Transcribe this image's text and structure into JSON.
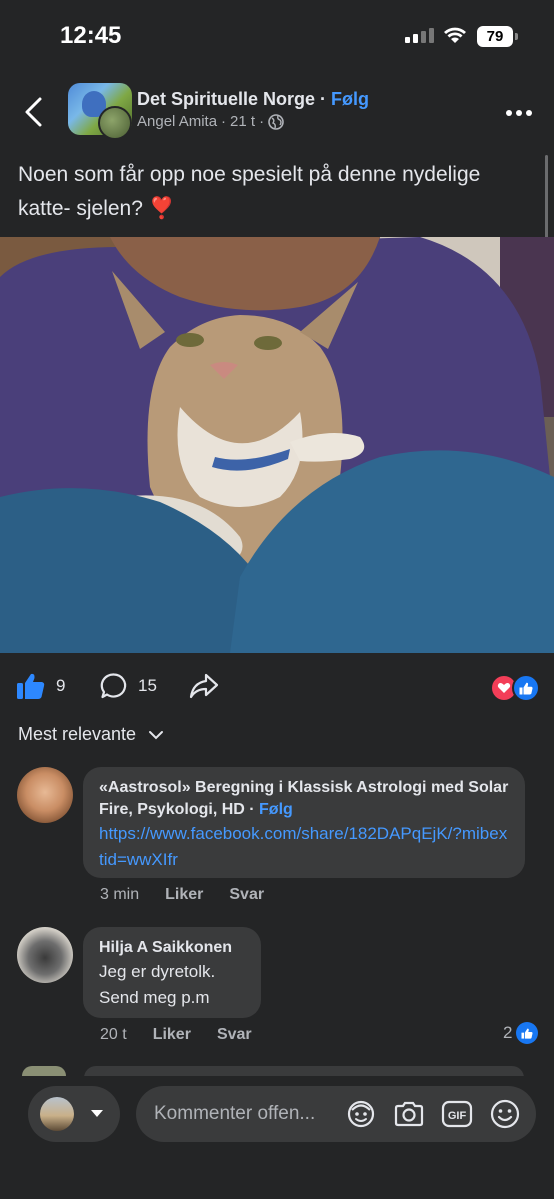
{
  "status_bar": {
    "time": "12:45",
    "battery": "79"
  },
  "header": {
    "page_name": "Det Spirituelle Norge",
    "separator": " · ",
    "follow_label": "Følg",
    "author": "Angel Amita",
    "time_ago": "21 t"
  },
  "post": {
    "caption": "Noen som får opp noe spesielt på denne nydelige katte- sjelen? ❣️"
  },
  "actions": {
    "likes": "9",
    "comments": "15"
  },
  "sort_label": "Mest relevante",
  "comments": [
    {
      "author": "«Aastrosol» Beregning i Klassisk Astrologi med Solar Fire, Psykologi, HD",
      "follow": "Følg",
      "link": "https://www.facebook.com/share/182DAPqEjK/?mibextid=wwXIfr",
      "time": "3 min",
      "like_label": "Liker",
      "reply_label": "Svar"
    },
    {
      "author": "Hilja A Saikkonen",
      "text_lines": [
        "Jeg er dyretolk.",
        "Send meg p.m"
      ],
      "time": "20 t",
      "like_label": "Liker",
      "reply_label": "Svar",
      "like_count": "2"
    }
  ],
  "composer": {
    "placeholder": "Kommenter offen..."
  },
  "colors": {
    "background": "#242526",
    "bubble": "#3a3b3c",
    "accent": "#4599ff",
    "like_blue": "#1877f2",
    "love_red": "#f33e58"
  },
  "icons": [
    "back-icon",
    "globe-icon",
    "more-icon",
    "like-icon",
    "comment-icon",
    "share-icon",
    "love-reaction-icon",
    "like-reaction-icon",
    "chevron-down-icon",
    "avatar-sticker-icon",
    "camera-icon",
    "gif-icon",
    "emoji-icon"
  ]
}
